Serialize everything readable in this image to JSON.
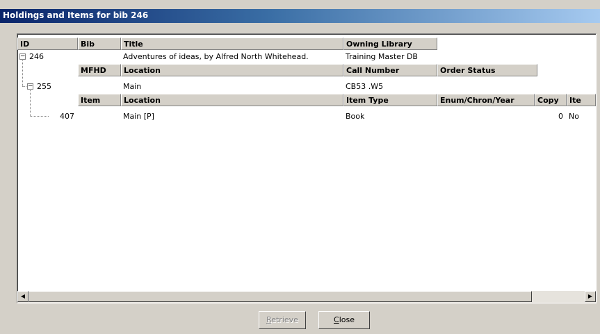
{
  "window": {
    "title": "Holdings and Items for bib 246"
  },
  "grid": {
    "bib_headers": {
      "id": "ID",
      "bib": "Bib",
      "title": "Title",
      "owning_library": "Owning Library"
    },
    "bib_row": {
      "id": "246",
      "title": "Adventures of ideas, by Alfred North Whitehead.",
      "owning_library": "Training Master DB"
    },
    "mfhd_headers": {
      "mfhd": "MFHD",
      "location": "Location",
      "call_number": "Call Number",
      "order_status": "Order Status"
    },
    "mfhd_row": {
      "id": "255",
      "location": "Main",
      "call_number": "CB53 .W5"
    },
    "item_headers": {
      "item": "Item",
      "location": "Location",
      "item_type": "Item Type",
      "enum": "Enum/Chron/Year",
      "copy": "Copy",
      "ite": "Ite"
    },
    "item_row": {
      "id": "407",
      "location": "Main [P]",
      "item_type": "Book",
      "copy": "0",
      "ite": "No"
    }
  },
  "buttons": {
    "retrieve": {
      "first": "R",
      "rest": "etrieve"
    },
    "close": {
      "first": "C",
      "rest": "lose"
    }
  }
}
